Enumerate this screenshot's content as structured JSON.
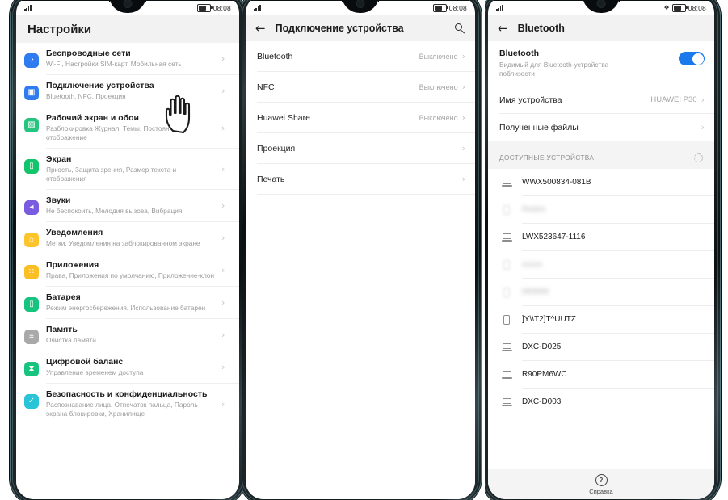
{
  "statusbar": {
    "time": "08:08",
    "signal_icon": "signal-bars-icon",
    "battery_icon": "battery-icon",
    "bluetooth_icon": "bluetooth-icon"
  },
  "screen1": {
    "title": "Настройки",
    "items": [
      {
        "title": "Беспроводные сети",
        "sub": "Wi-Fi, Настройки SIM-карт, Мобильная сеть",
        "icon": "wifi-icon",
        "color": "#2f7bf0",
        "glyph": "◔"
      },
      {
        "title": "Подключение устройства",
        "sub": "Bluetooth, NFC, Проекция",
        "icon": "device-connect-icon",
        "color": "#2f7bf0",
        "glyph": "▣"
      },
      {
        "title": "Рабочий экран и обои",
        "sub": "Разблокировка Журнал, Темы, Постоянное отображение",
        "icon": "home-wallpaper-icon",
        "color": "#25c57f",
        "glyph": "▨"
      },
      {
        "title": "Экран",
        "sub": "Яркость, Защита зрения, Размер текста и отображения",
        "icon": "display-icon",
        "color": "#14c46a",
        "glyph": "▯"
      },
      {
        "title": "Звуки",
        "sub": "Не беспокоить, Мелодия вызова, Вибрация",
        "icon": "sound-icon",
        "color": "#7b5ce0",
        "glyph": "◂"
      },
      {
        "title": "Уведомления",
        "sub": "Метки, Уведомления на заблокированном экране",
        "icon": "notifications-icon",
        "color": "#fdc42b",
        "glyph": "⌂"
      },
      {
        "title": "Приложения",
        "sub": "Права, Приложения по умолчанию, Приложение-клон",
        "icon": "apps-icon",
        "color": "#fbbf24",
        "glyph": "∷"
      },
      {
        "title": "Батарея",
        "sub": "Режим энергосбережения, Использование батареи",
        "icon": "battery-settings-icon",
        "color": "#16c47f",
        "glyph": "▯"
      },
      {
        "title": "Память",
        "sub": "Очистка памяти",
        "icon": "storage-icon",
        "color": "#a9a9a9",
        "glyph": "≡"
      },
      {
        "title": "Цифровой баланс",
        "sub": "Управление временем доступа",
        "icon": "digital-balance-icon",
        "color": "#16c47f",
        "glyph": "⧗"
      },
      {
        "title": "Безопасность и конфиденциальность",
        "sub": "Распознавание лица, Отпечаток пальца, Пароль экрана блокировки, Хранилище",
        "icon": "security-icon",
        "color": "#2ac4d8",
        "glyph": "✓"
      }
    ],
    "chevron": "›"
  },
  "screen2": {
    "title": "Подключение устройства",
    "back_icon": "back-arrow-icon",
    "search_icon": "search-icon",
    "chevron": "›",
    "items": [
      {
        "label": "Bluetooth",
        "value": "Выключено"
      },
      {
        "label": "NFC",
        "value": "Выключено"
      },
      {
        "label": "Huawei Share",
        "value": "Выключено"
      },
      {
        "label": "Проекция",
        "value": ""
      },
      {
        "label": "Печать",
        "value": ""
      }
    ]
  },
  "screen3": {
    "title": "Bluetooth",
    "back_icon": "back-arrow-icon",
    "chevron": "›",
    "bluetooth": {
      "title": "Bluetooth",
      "sub": "Видимый для Bluetooth-устройства поблизости",
      "enabled": true,
      "toggle_color": "#1a7aec"
    },
    "rows": [
      {
        "label": "Имя устройства",
        "value": "HUAWEI P30"
      },
      {
        "label": "Полученные файлы",
        "value": ""
      }
    ],
    "section_header": "ДОСТУПНЫЕ УСТРОЙСТВА",
    "scanning_icon": "scanning-spinner-icon",
    "devices": [
      {
        "name": "WWX500834-081B",
        "icon": "laptop-icon",
        "blurred": false
      },
      {
        "name": "Redmi",
        "icon": "mobile-icon",
        "blurred": true
      },
      {
        "name": "LWX523647-1116",
        "icon": "laptop-icon",
        "blurred": false
      },
      {
        "name": "xxxxx",
        "icon": "mobile-icon",
        "blurred": true
      },
      {
        "name": "MMMM",
        "icon": "mobile-icon",
        "blurred": true
      },
      {
        "name": "]Y\\\\T2]T^UUTZ",
        "icon": "mobile-icon",
        "blurred": false
      },
      {
        "name": "DXC-D025",
        "icon": "laptop-icon",
        "blurred": false
      },
      {
        "name": "R90PM6WC",
        "icon": "laptop-icon",
        "blurred": false
      },
      {
        "name": "DXC-D003",
        "icon": "laptop-icon",
        "blurred": false
      }
    ],
    "help": {
      "label": "Справка",
      "icon": "help-icon",
      "glyph": "?"
    }
  },
  "cursor": {
    "icon": "pointing-hand-cursor"
  }
}
